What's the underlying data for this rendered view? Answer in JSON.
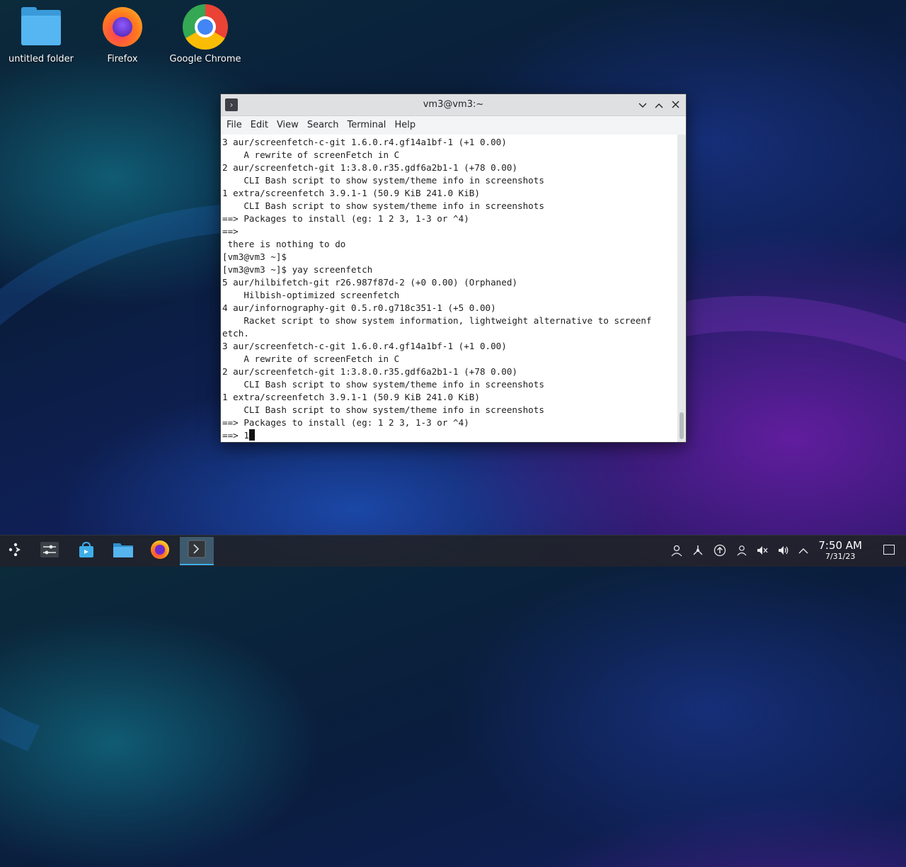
{
  "desktop": {
    "icons": [
      {
        "label": "untitled folder",
        "icon": "folder-icon"
      },
      {
        "label": "Firefox",
        "icon": "firefox-icon"
      },
      {
        "label": "Google Chrome",
        "icon": "chrome-icon"
      }
    ]
  },
  "window": {
    "title": "vm3@vm3:~",
    "menu": [
      "File",
      "Edit",
      "View",
      "Search",
      "Terminal",
      "Help"
    ],
    "lines": [
      "3 aur/screenfetch-c-git 1.6.0.r4.gf14a1bf-1 (+1 0.00)",
      "    A rewrite of screenFetch in C",
      "2 aur/screenfetch-git 1:3.8.0.r35.gdf6a2b1-1 (+78 0.00)",
      "    CLI Bash script to show system/theme info in screenshots",
      "1 extra/screenfetch 3.9.1-1 (50.9 KiB 241.0 KiB)",
      "    CLI Bash script to show system/theme info in screenshots",
      "==> Packages to install (eg: 1 2 3, 1-3 or ^4)",
      "==>",
      " there is nothing to do",
      "[vm3@vm3 ~]$",
      "[vm3@vm3 ~]$ yay screenfetch",
      "5 aur/hilbifetch-git r26.987f87d-2 (+0 0.00) (Orphaned)",
      "    Hilbish-optimized screenfetch",
      "4 aur/infornography-git 0.5.r0.g718c351-1 (+5 0.00)",
      "    Racket script to show system information, lightweight alternative to screenf",
      "etch.",
      "3 aur/screenfetch-c-git 1.6.0.r4.gf14a1bf-1 (+1 0.00)",
      "    A rewrite of screenFetch in C",
      "2 aur/screenfetch-git 1:3.8.0.r35.gdf6a2b1-1 (+78 0.00)",
      "    CLI Bash script to show system/theme info in screenshots",
      "1 extra/screenfetch 3.9.1-1 (50.9 KiB 241.0 KiB)",
      "    CLI Bash script to show system/theme info in screenshots",
      "==> Packages to install (eg: 1 2 3, 1-3 or ^4)"
    ],
    "prompt_line": "==> 1"
  },
  "taskbar": {
    "apps": [
      "launcher-icon",
      "system-settings-icon",
      "discover-icon",
      "dolphin-icon",
      "firefox-icon",
      "konsole-icon"
    ],
    "active_app": "konsole-icon",
    "tray": [
      "user-icon",
      "kde-connect-icon",
      "update-icon",
      "user-switch-icon",
      "mute-icon",
      "volume-icon",
      "chevron-up-icon"
    ],
    "time": "7:50 AM",
    "date": "7/31/23"
  },
  "colors": {
    "accent": "#3daee9",
    "titlebar": "#dee0e2",
    "taskbar": "#202328"
  }
}
